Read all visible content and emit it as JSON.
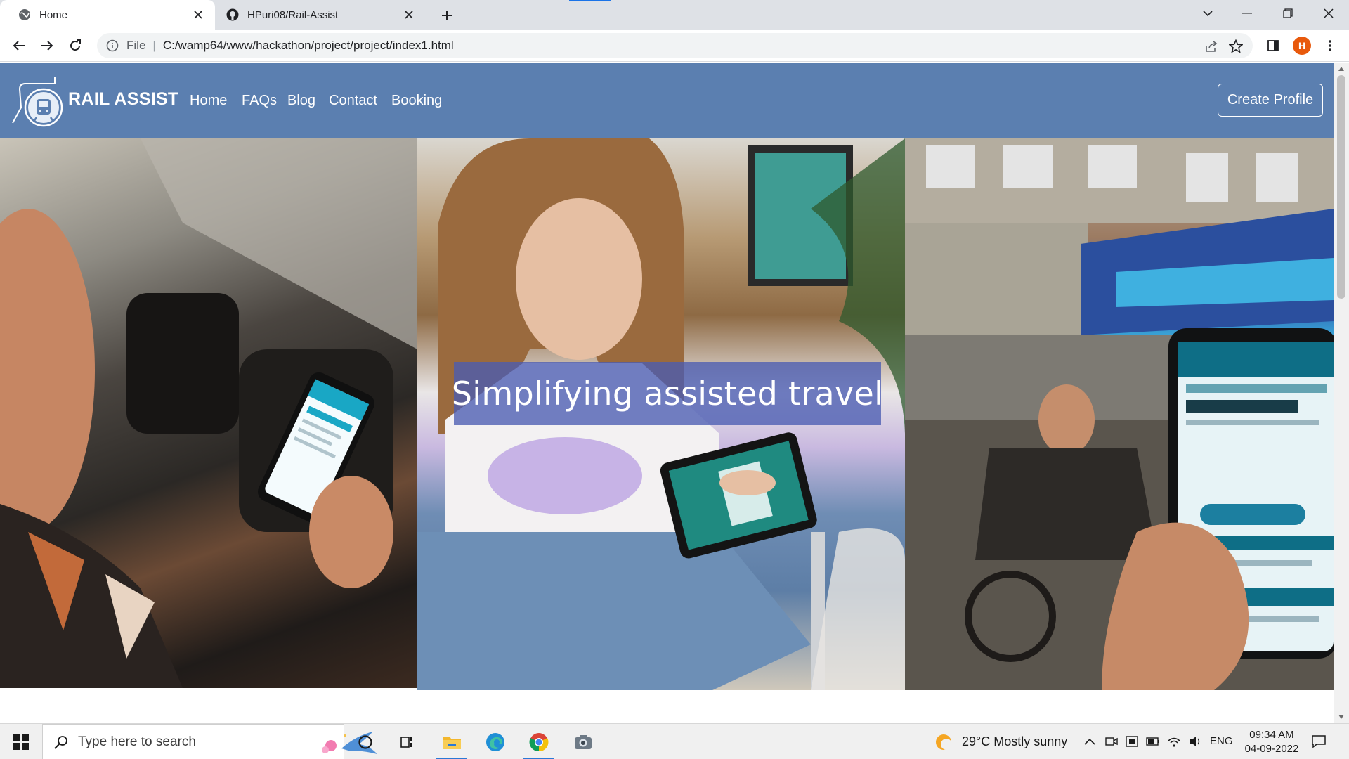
{
  "browser": {
    "tabs": [
      {
        "title": "Home",
        "icon": "globe-icon",
        "active": true
      },
      {
        "title": "HPuri08/Rail-Assist",
        "icon": "github-icon",
        "active": false
      }
    ],
    "omnibox": {
      "scheme": "File",
      "url": "C:/wamp64/www/hackathon/project/project/index1.html"
    },
    "profile_initial": "H"
  },
  "site": {
    "brand": "RAIL ASSIST",
    "nav": [
      "Home",
      "FAQs",
      "Blog",
      "Contact",
      "Booking"
    ],
    "create_profile": "Create Profile",
    "headline": "Simplifying assisted travel",
    "colors": {
      "navbar": "#5b7fb0",
      "headline_box": "#4a5cb2"
    }
  },
  "taskbar": {
    "search_placeholder": "Type here to search",
    "weather": "29°C  Mostly sunny",
    "language": "ENG",
    "time": "09:34 AM",
    "date": "04-09-2022",
    "apps": [
      "cortana-icon",
      "task-view-icon",
      "file-explorer-icon",
      "edge-icon",
      "chrome-icon",
      "camera-icon"
    ]
  }
}
